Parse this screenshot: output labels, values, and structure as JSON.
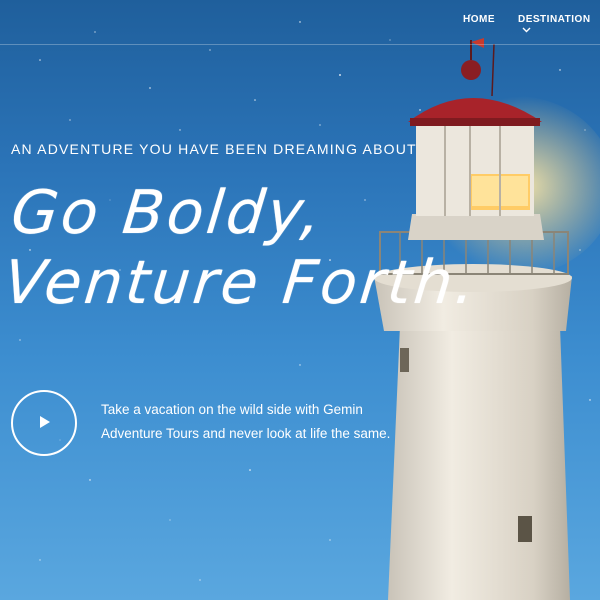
{
  "nav": {
    "home_label": "HOME",
    "destination_label": "DESTINATION"
  },
  "hero": {
    "tagline": "AN ADVENTURE YOU HAVE BEEN DREAMING ABOUT",
    "headline_line1": "Go Boldy,",
    "headline_line2": "Venture Forth.",
    "description": "Take a vacation on the wild side with Gemin Adventure Tours and never look at life the same."
  },
  "colors": {
    "sky_top": "#1f5f9c",
    "sky_bottom": "#5aa7df",
    "text": "#ffffff",
    "lighthouse_body": "#e9e4da",
    "lamp_glow": "#ffd27a",
    "roof_red": "#a8232a"
  },
  "icons": {
    "play": "play-icon",
    "dropdown": "chevron-down-icon"
  }
}
